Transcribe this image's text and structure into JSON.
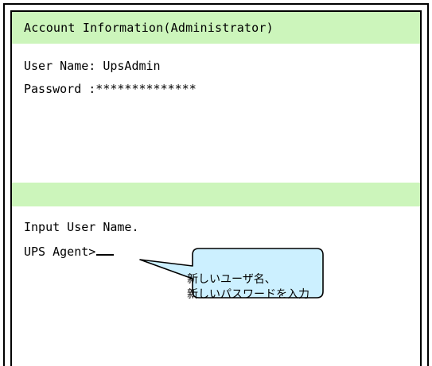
{
  "header": {
    "title": "Account Information(Administrator)"
  },
  "account": {
    "user_name": "User Name: UpsAdmin",
    "password": "Password :**************"
  },
  "prompt": {
    "instruction": "Input User Name.",
    "agent_prompt": "UPS Agent>"
  },
  "callout": {
    "line1": "新しいユーザ名、",
    "line2": "新しいパスワードを入力"
  },
  "colors": {
    "band_green": "#ccf5bb",
    "callout_fill": "#ccf0ff",
    "border": "#000000"
  }
}
